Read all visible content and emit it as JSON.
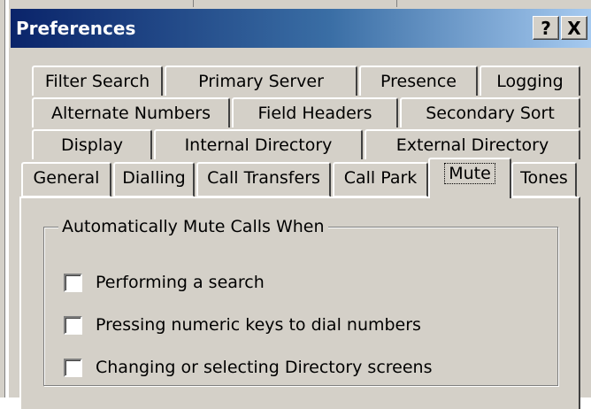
{
  "window": {
    "title": "Preferences",
    "help_button": "?",
    "close_button": "X"
  },
  "tabs": {
    "row1": [
      "Filter Search",
      "Primary Server",
      "Presence",
      "Logging"
    ],
    "row2": [
      "Alternate Numbers",
      "Field Headers",
      "Secondary Sort"
    ],
    "row3": [
      "Display",
      "Internal Directory",
      "External Directory"
    ],
    "row4": [
      "General",
      "Dialling",
      "Call Transfers",
      "Call Park",
      "Mute",
      "Tones"
    ],
    "active": "Mute"
  },
  "mute": {
    "group_title": "Automatically Mute Calls When",
    "options": [
      {
        "label": "Performing a search",
        "checked": false
      },
      {
        "label": "Pressing numeric keys to dial numbers",
        "checked": false
      },
      {
        "label": "Changing or selecting Directory screens",
        "checked": false
      }
    ]
  }
}
